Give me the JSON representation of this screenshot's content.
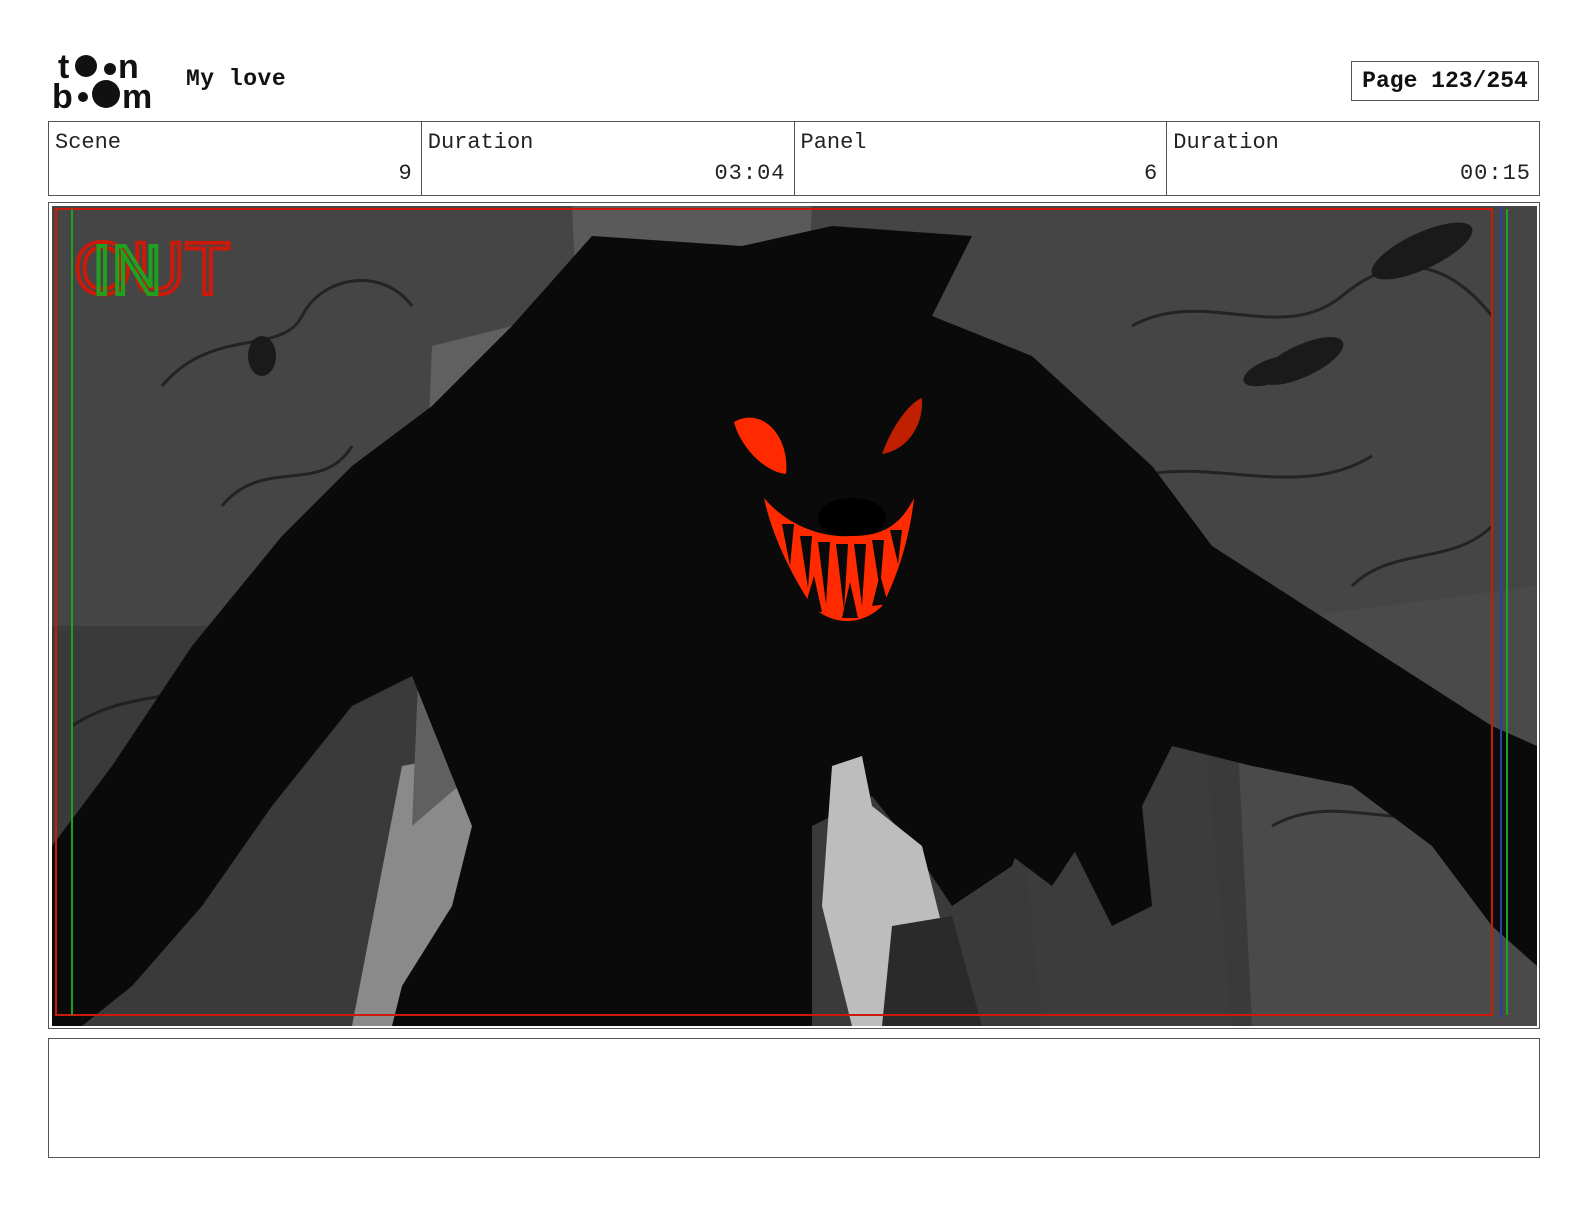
{
  "header": {
    "logo_text_top": "toon",
    "logo_text_bottom": "boom",
    "project_title": "My love",
    "page_label": "Page 123/254"
  },
  "info": {
    "scene_label": "Scene",
    "scene_value": "9",
    "scene_duration_label": "Duration",
    "scene_duration_value": "03:04",
    "panel_label": "Panel",
    "panel_value": "6",
    "panel_duration_label": "Duration",
    "panel_duration_value": "00:15"
  },
  "panel_image": {
    "overlay_out": "OUT",
    "overlay_in": "IN",
    "accent_red": "#cc1a0a",
    "accent_green": "#1fa01f",
    "monster_black": "#0a0a0a",
    "eye_orange": "#ff2a00"
  },
  "caption": {
    "text": ""
  }
}
